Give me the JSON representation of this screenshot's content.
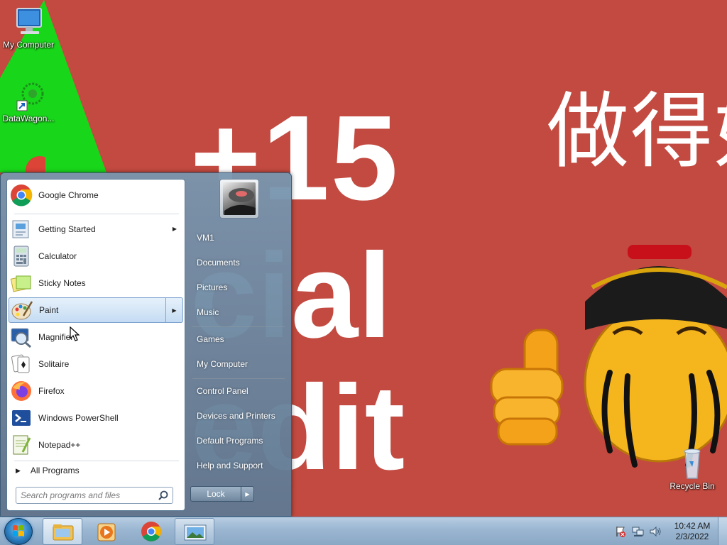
{
  "desktop": {
    "wallpaper_text_line1": "+15",
    "wallpaper_text_line2": "cial",
    "wallpaper_text_line3": "edit",
    "wallpaper_text_cn": "做得好",
    "icons": [
      {
        "label": "My Computer",
        "icon": "computer-icon"
      },
      {
        "label": "DataWagon...",
        "icon": "datawagon-icon"
      },
      {
        "label": "Recycle Bin",
        "icon": "recycle-bin-icon"
      }
    ]
  },
  "start_menu": {
    "programs": [
      {
        "label": "Google Chrome",
        "icon": "chrome-icon",
        "submenu": false
      },
      {
        "label": "Getting Started",
        "icon": "getting-started-icon",
        "submenu": true
      },
      {
        "label": "Calculator",
        "icon": "calculator-icon",
        "submenu": false
      },
      {
        "label": "Sticky Notes",
        "icon": "sticky-notes-icon",
        "submenu": false
      },
      {
        "label": "Paint",
        "icon": "paint-icon",
        "submenu": true,
        "selected": true
      },
      {
        "label": "Magnifier",
        "icon": "magnifier-icon",
        "submenu": false
      },
      {
        "label": "Solitaire",
        "icon": "solitaire-icon",
        "submenu": false
      },
      {
        "label": "Firefox",
        "icon": "firefox-icon",
        "submenu": false
      },
      {
        "label": "Windows PowerShell",
        "icon": "powershell-icon",
        "submenu": false
      },
      {
        "label": "Notepad++",
        "icon": "notepadpp-icon",
        "submenu": false
      }
    ],
    "all_programs_label": "All Programs",
    "search_placeholder": "Search programs and files",
    "right_links": {
      "user": "VM1",
      "documents": "Documents",
      "pictures": "Pictures",
      "music": "Music",
      "games": "Games",
      "my_computer": "My Computer",
      "control_panel": "Control Panel",
      "devices_printers": "Devices and Printers",
      "default_programs": "Default Programs",
      "help_support": "Help and Support"
    },
    "lock_label": "Lock"
  },
  "taskbar": {
    "pinned": [
      "explorer-icon",
      "media-player-icon",
      "chrome-icon",
      "picture-viewer-icon"
    ],
    "clock_time": "10:42 AM",
    "clock_date": "2/3/2022",
    "accent": "#2e84c6"
  }
}
